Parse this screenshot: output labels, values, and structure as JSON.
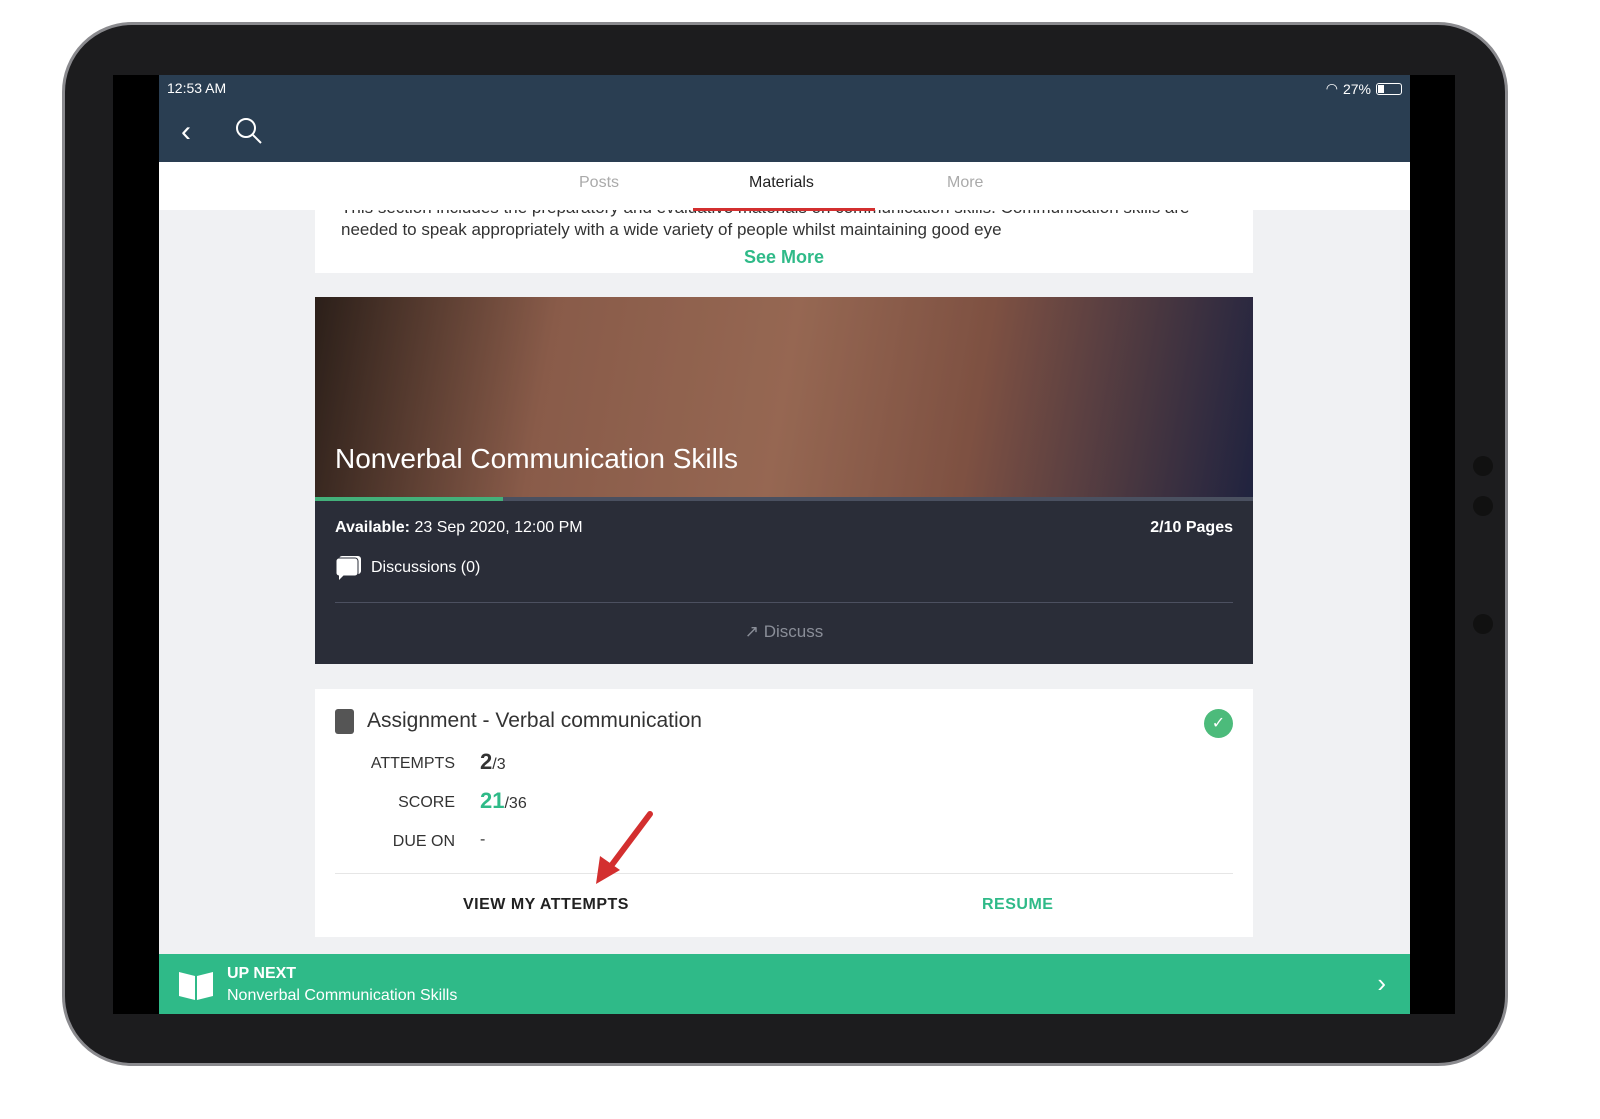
{
  "status": {
    "time": "12:53 AM",
    "battery": "27%",
    "battery_level": 0.27
  },
  "tabs": [
    {
      "label": "Posts"
    },
    {
      "label": "Materials",
      "active": true
    },
    {
      "label": "More"
    }
  ],
  "description": {
    "text": "This section includes the preparatory and evaluative materials on communication skills. Communication skills are needed to speak appropriately with a wide variety of people whilst maintaining good eye",
    "see_more": "See More"
  },
  "material": {
    "title": "Nonverbal Communication Skills",
    "progress": 0.2,
    "available_label": "Available:",
    "available_value": "23 Sep 2020, 12:00 PM",
    "pages": "2/10 Pages",
    "discussions": "Discussions (0)",
    "discuss": "Discuss"
  },
  "assignment": {
    "title": "Assignment - Verbal communication",
    "attempts_label": "ATTEMPTS",
    "attempts_value": "2",
    "attempts_total": "/3",
    "score_label": "SCORE",
    "score_value": "21",
    "score_total": "/36",
    "due_label": "DUE ON",
    "due_value": "-",
    "view_attempts": "VIEW MY ATTEMPTS",
    "resume": "RESUME"
  },
  "up_next": {
    "label": "UP NEXT",
    "title": "Nonverbal Communication Skills"
  },
  "colors": {
    "accent": "#2fba88",
    "header": "#2a3e52",
    "tab_indicator": "#d32f2f",
    "annotation_arrow": "#d32f2f"
  }
}
